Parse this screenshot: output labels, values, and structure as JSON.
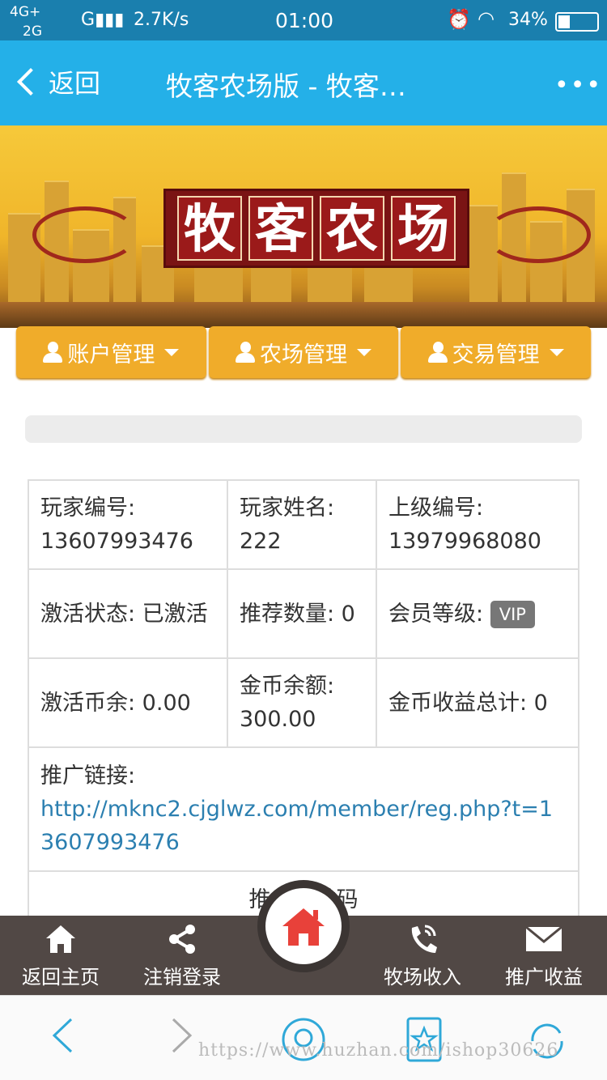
{
  "status_bar": {
    "network_top": "4G+",
    "network_bottom": "2G",
    "carrier_signal": "G",
    "speed": "2.7K/s",
    "time": "01:00",
    "battery": "34%"
  },
  "nav": {
    "back_label": "返回",
    "title": "牧客农场版 - 牧客…",
    "more_label": "•••"
  },
  "banner": {
    "logo_chars": [
      "牧",
      "客",
      "农",
      "场"
    ]
  },
  "menu": {
    "items": [
      {
        "label": "账户管理"
      },
      {
        "label": "农场管理"
      },
      {
        "label": "交易管理"
      }
    ]
  },
  "info": {
    "player_id_label": "玩家编号:",
    "player_id": "13607993476",
    "player_name_label": "玩家姓名:",
    "player_name": "222",
    "parent_id_label": "上级编号:",
    "parent_id": "13979968080",
    "activation_status": "激活状态: 已激活",
    "referral_count": "推荐数量: 0",
    "member_level_label": "会员等级:",
    "member_level": "VIP",
    "activation_coins": "激活币余: 0.00",
    "gold_balance_label": "金币余额:",
    "gold_balance": "300.00",
    "gold_income_total": "金币收益总计: 0",
    "promo_link_label": "推广链接:",
    "promo_link": "http://mknc2.cjglwz.com/member/reg.php?t=13607993476",
    "promo_qr_label": "推广二维码"
  },
  "tabbar": {
    "items": [
      {
        "label": "返回主页",
        "icon": "home-icon"
      },
      {
        "label": "注销登录",
        "icon": "share-icon"
      },
      {
        "label": "牧场收入",
        "icon": "phone-icon"
      },
      {
        "label": "推广收益",
        "icon": "mail-icon"
      }
    ]
  },
  "watermark": "https://www.huzhan.com/ishop30626",
  "colors": {
    "nav_bg": "#24b0e8",
    "menu_bg": "#f0ac2a",
    "tabbar_bg": "#514845",
    "link": "#2b7fb0",
    "home_red": "#e8413a"
  }
}
